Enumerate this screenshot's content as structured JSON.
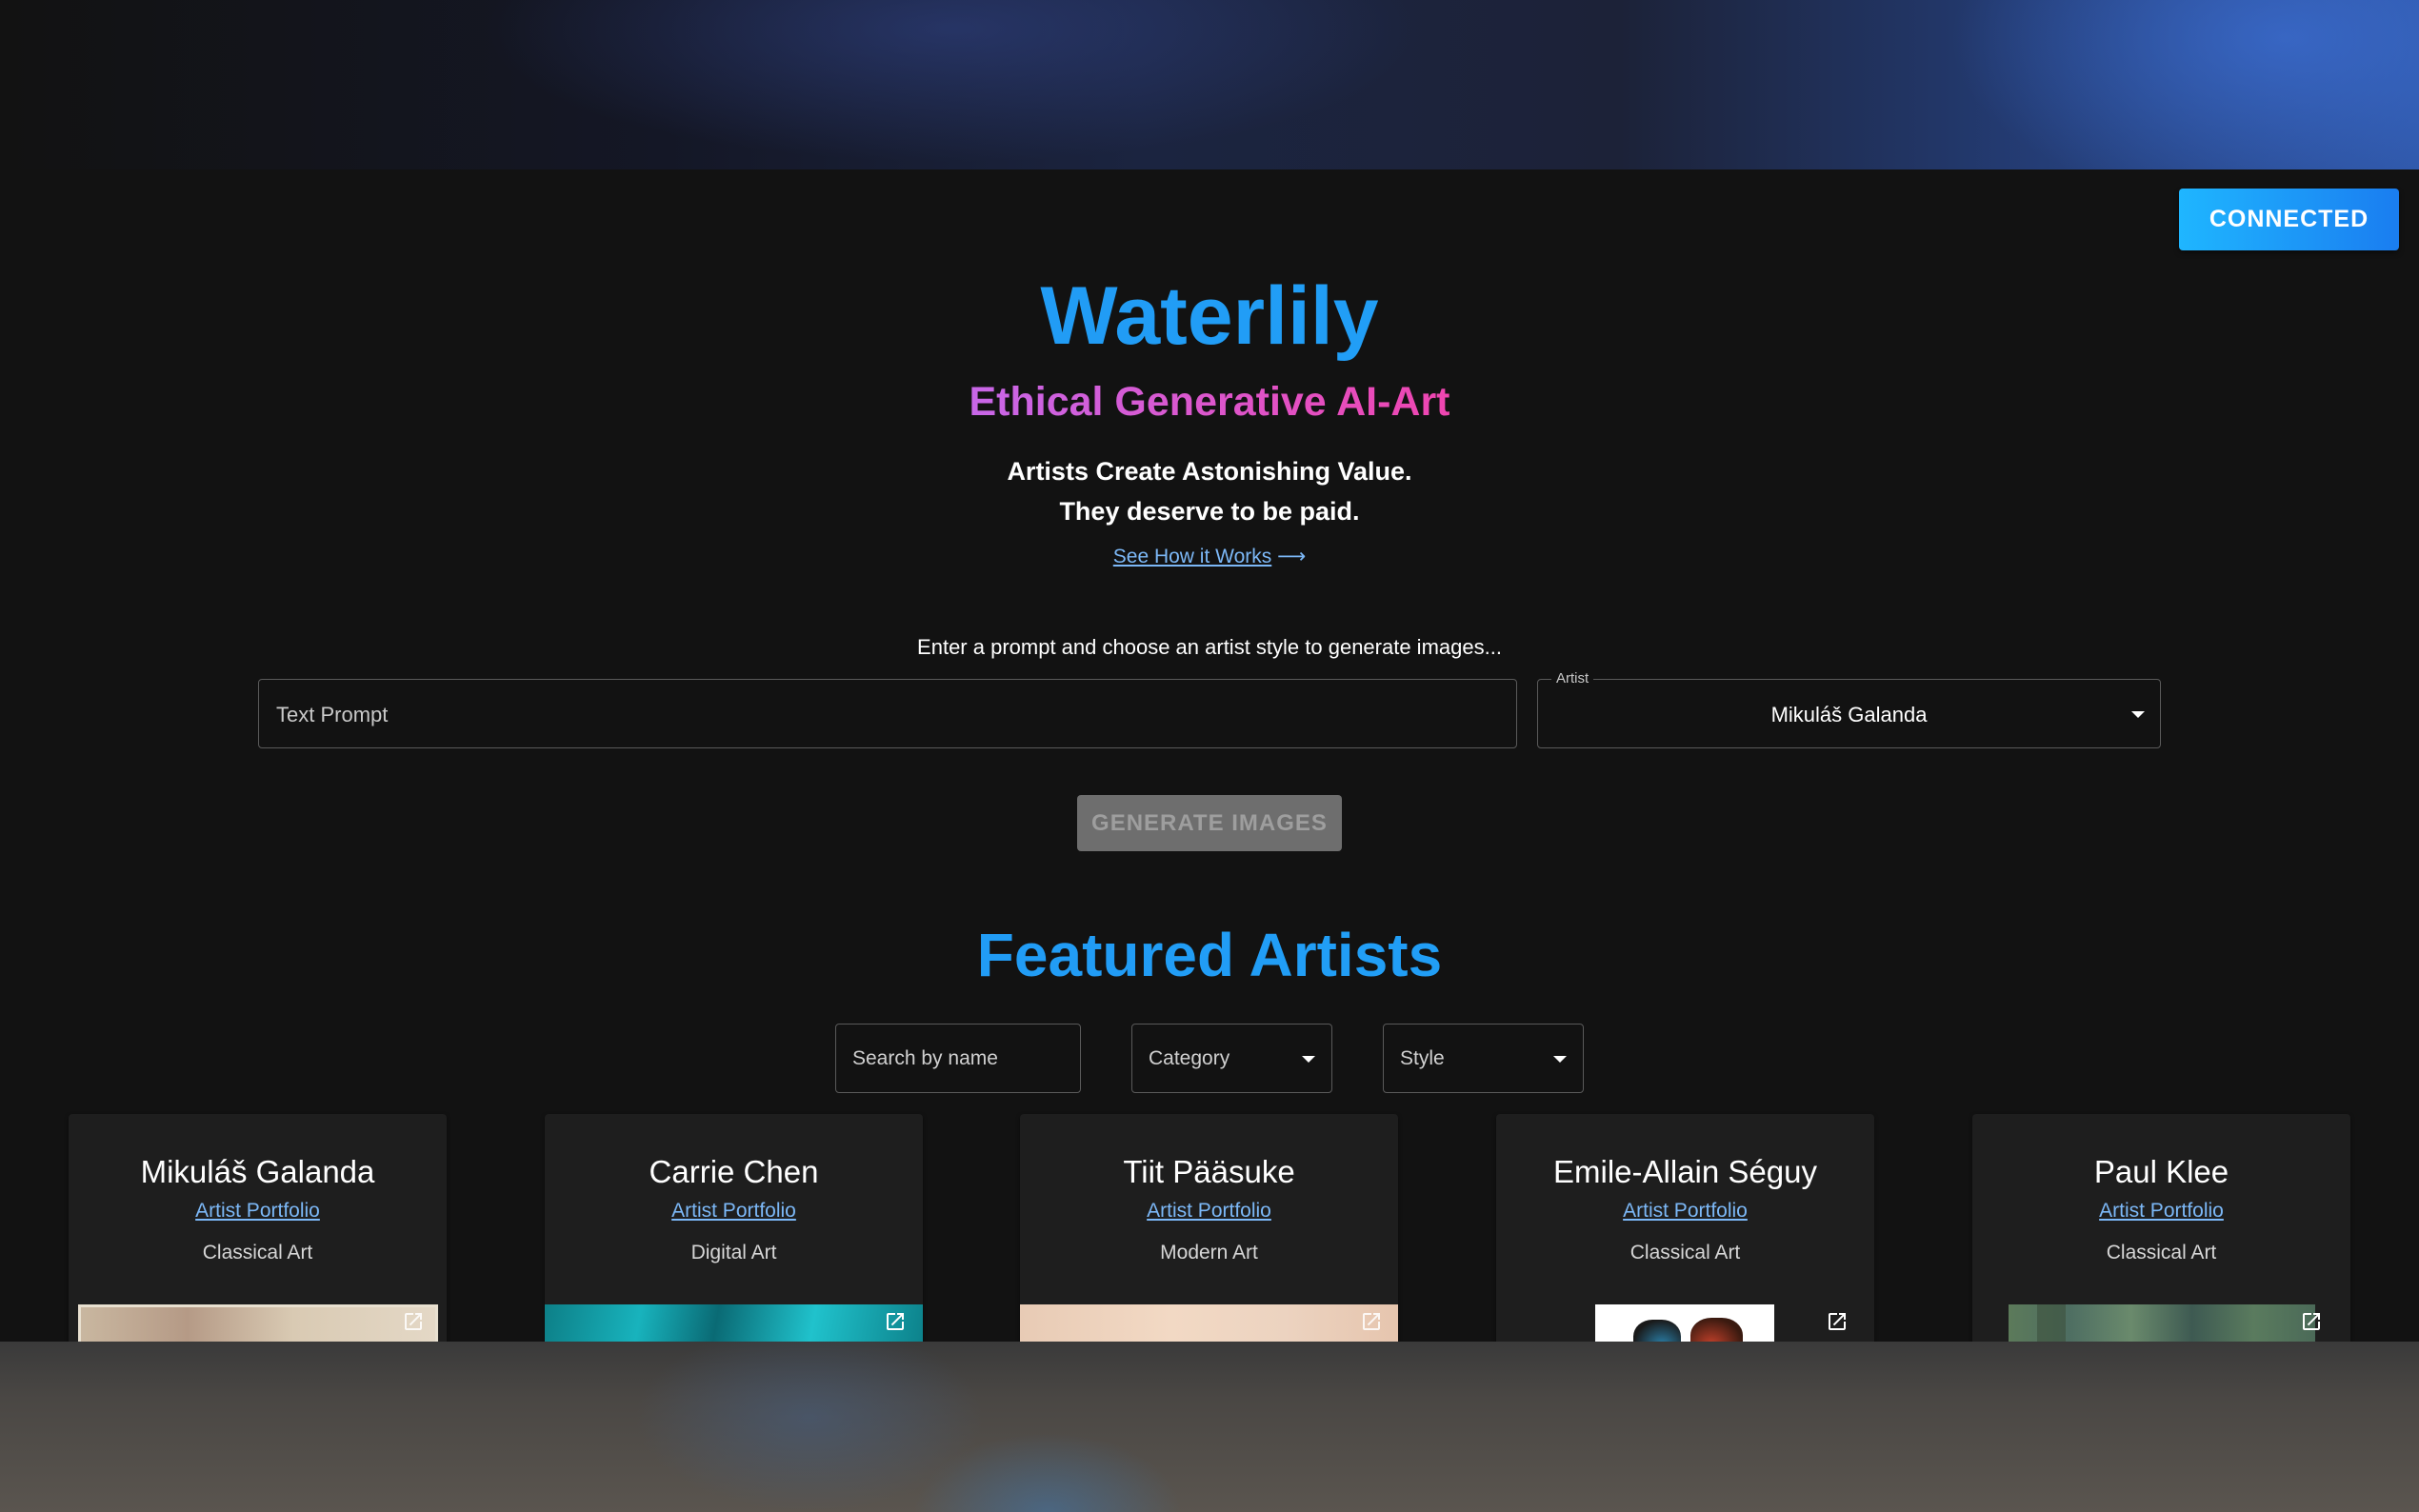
{
  "header": {
    "connected_label": "CONNECTED",
    "connected_color": "#1a8ff5"
  },
  "hero": {
    "title": "Waterlily",
    "subtitle": "Ethical Generative AI-Art",
    "tagline_1": "Artists Create Astonishing Value.",
    "tagline_2": "They deserve to be paid.",
    "how_link": "See How it Works",
    "how_arrow": "⟶"
  },
  "generator": {
    "instructions": "Enter a prompt and choose an artist style to generate images...",
    "prompt_placeholder": "Text Prompt",
    "artist_label": "Artist",
    "artist_value": "Mikuláš Galanda",
    "generate_label": "GENERATE IMAGES"
  },
  "featured": {
    "title": "Featured Artists",
    "search_placeholder": "Search by name",
    "category_label": "Category",
    "style_label": "Style",
    "portfolio_label": "Artist Portfolio",
    "artists": [
      {
        "name": "Mikuláš Galanda",
        "category": "Classical Art"
      },
      {
        "name": "Carrie Chen",
        "category": "Digital Art"
      },
      {
        "name": "Tiit Pääsuke",
        "category": "Modern Art"
      },
      {
        "name": "Emile-Allain Séguy",
        "category": "Classical Art"
      },
      {
        "name": "Paul Klee",
        "category": "Classical Art"
      }
    ]
  },
  "icons": {
    "external_link": "external-link-icon",
    "dropdown": "chevron-down-icon"
  }
}
